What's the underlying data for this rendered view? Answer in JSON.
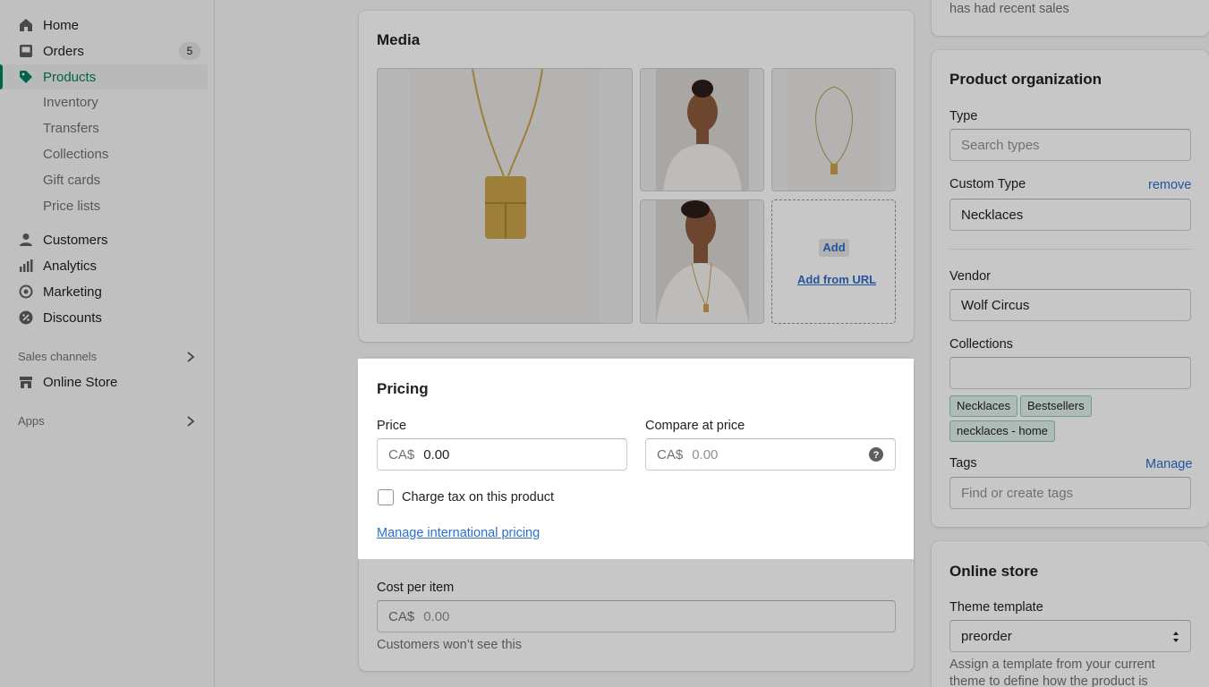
{
  "sidebar": {
    "home": "Home",
    "orders": "Orders",
    "orders_badge": "5",
    "products": "Products",
    "sub": [
      "Inventory",
      "Transfers",
      "Collections",
      "Gift cards",
      "Price lists"
    ],
    "customers": "Customers",
    "analytics": "Analytics",
    "marketing": "Marketing",
    "discounts": "Discounts",
    "sales_channels": "Sales channels",
    "online_store": "Online Store",
    "apps": "Apps"
  },
  "media": {
    "title": "Media",
    "add_label": "Add",
    "add_url_label": "Add from URL"
  },
  "pricing": {
    "title": "Pricing",
    "price_label": "Price",
    "price_prefix": "CA$",
    "price_value": "0.00",
    "compare_label": "Compare at price",
    "compare_prefix": "CA$",
    "compare_placeholder": "0.00",
    "tax_label": "Charge tax on this product",
    "tax_checked": false,
    "intl_link": "Manage international pricing",
    "cost_label": "Cost per item",
    "cost_prefix": "CA$",
    "cost_placeholder": "0.00",
    "cost_help": "Customers won’t see this"
  },
  "top_right": {
    "text": "has had recent sales"
  },
  "organization": {
    "title": "Product organization",
    "type_label": "Type",
    "type_placeholder": "Search types",
    "custom_type_label": "Custom Type",
    "remove_link": "remove",
    "custom_type_value": "Necklaces",
    "vendor_label": "Vendor",
    "vendor_value": "Wolf Circus",
    "collections_label": "Collections",
    "collections_tags": [
      "Necklaces",
      "Bestsellers",
      "necklaces - home"
    ],
    "tags_label": "Tags",
    "manage_link": "Manage",
    "tags_placeholder": "Find or create tags"
  },
  "online_store": {
    "title": "Online store",
    "theme_label": "Theme template",
    "theme_value": "preorder",
    "help_line1": "Assign a template from your current",
    "help_line2": "theme to define how the product is"
  },
  "colors": {
    "accent": "#008060",
    "link": "#2c6ecb"
  }
}
